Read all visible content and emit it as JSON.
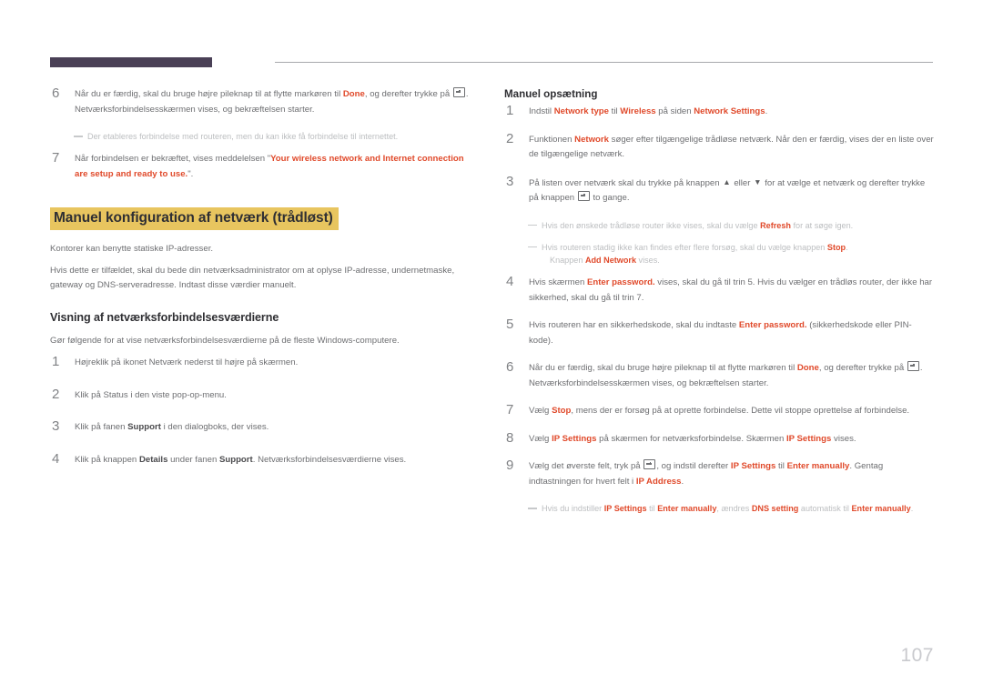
{
  "page": {
    "number": "107"
  },
  "header": {
    "accent_color": "#4a4056",
    "rule_color": "#a7a9ac"
  },
  "theme": {
    "keyword_color": "#e0492a",
    "heading_highlight": "#e8c55f",
    "body_text_color": "#6d6e71",
    "note_text_color": "#bcbec0"
  },
  "left_column": {
    "steps_continued": [
      {
        "num": "6",
        "parts": [
          {
            "t": "Når du er færdig, skal du bruge højre pileknap til at flytte markøren til ",
            "s": "plain"
          },
          {
            "t": "Done",
            "s": "kw"
          },
          {
            "t": ", og derefter trykke på ",
            "s": "plain"
          },
          {
            "t": "ENTER_ICON",
            "s": "icon"
          },
          {
            "t": ". Netværksforbindelsesskærmen vises, og bekræftelsen starter.",
            "s": "plain"
          }
        ],
        "note": {
          "parts": [
            {
              "t": "Der etableres forbindelse med routeren, men du kan ikke få forbindelse til internettet.",
              "s": "plain"
            }
          ]
        }
      },
      {
        "num": "7",
        "parts": [
          {
            "t": "Når forbindelsen er bekræftet, vises meddelelsen \"",
            "s": "plain"
          },
          {
            "t": "Your wireless network and Internet connection are setup and ready to use.",
            "s": "kw"
          },
          {
            "t": "\".",
            "s": "plain"
          }
        ]
      }
    ],
    "chapter_heading": "Manuel konfiguration af netværk (trådløst)",
    "intro_paragraphs": [
      "Kontorer kan benytte statiske IP-adresser.",
      "Hvis dette er tilfældet, skal du bede din netværksadministrator om at oplyse IP-adresse, undernetmaske, gateway og DNS-serveradresse. Indtast disse værdier manuelt."
    ],
    "sub_heading": "Visning af netværksforbindelsesværdierne",
    "sub_intro": "Gør følgende for at vise netværksforbindelsesværdierne på de fleste Windows-computere.",
    "steps": [
      {
        "num": "1",
        "parts": [
          {
            "t": "Højreklik på ikonet Netværk nederst til højre på skærmen.",
            "s": "plain"
          }
        ]
      },
      {
        "num": "2",
        "parts": [
          {
            "t": "Klik på Status i den viste pop-op-menu.",
            "s": "plain"
          }
        ]
      },
      {
        "num": "3",
        "parts": [
          {
            "t": "Klik på fanen ",
            "s": "plain"
          },
          {
            "t": "Support",
            "s": "bold"
          },
          {
            "t": " i den dialogboks, der vises.",
            "s": "plain"
          }
        ]
      },
      {
        "num": "4",
        "parts": [
          {
            "t": "Klik på knappen ",
            "s": "plain"
          },
          {
            "t": "Details",
            "s": "bold"
          },
          {
            "t": " under fanen ",
            "s": "plain"
          },
          {
            "t": "Support",
            "s": "bold"
          },
          {
            "t": ". Netværksforbindelsesværdierne vises.",
            "s": "plain"
          }
        ]
      }
    ]
  },
  "right_column": {
    "heading": "Manuel opsætning",
    "steps": [
      {
        "num": "1",
        "parts": [
          {
            "t": "Indstil ",
            "s": "plain"
          },
          {
            "t": "Network type",
            "s": "kw"
          },
          {
            "t": " til ",
            "s": "plain"
          },
          {
            "t": "Wireless",
            "s": "kw"
          },
          {
            "t": " på siden ",
            "s": "plain"
          },
          {
            "t": "Network Settings",
            "s": "kw"
          },
          {
            "t": ".",
            "s": "plain"
          }
        ]
      },
      {
        "num": "2",
        "parts": [
          {
            "t": "Funktionen ",
            "s": "plain"
          },
          {
            "t": "Network",
            "s": "kw"
          },
          {
            "t": " søger efter tilgængelige trådløse netværk. Når den er færdig, vises der en liste over de tilgængelige netværk.",
            "s": "plain"
          }
        ]
      },
      {
        "num": "3",
        "parts": [
          {
            "t": "På listen over netværk skal du trykke på knappen ",
            "s": "plain"
          },
          {
            "t": "▲",
            "s": "arrow"
          },
          {
            "t": " eller ",
            "s": "plain"
          },
          {
            "t": "▼",
            "s": "arrow"
          },
          {
            "t": " for at vælge et netværk og derefter trykke på knappen ",
            "s": "plain"
          },
          {
            "t": "ENTER_ICON",
            "s": "icon"
          },
          {
            "t": " to gange.",
            "s": "plain"
          }
        ],
        "notes": [
          {
            "parts": [
              {
                "t": "Hvis den ønskede trådløse router ikke vises, skal du vælge ",
                "s": "plain"
              },
              {
                "t": "Refresh",
                "s": "kw"
              },
              {
                "t": " for at søge igen.",
                "s": "plain"
              }
            ]
          },
          {
            "parts": [
              {
                "t": "Hvis routeren stadig ikke kan findes efter flere forsøg, skal du vælge knappen ",
                "s": "plain"
              },
              {
                "t": "Stop",
                "s": "kw"
              },
              {
                "t": ".",
                "s": "plain"
              }
            ],
            "continuation": [
              {
                "t": "Knappen ",
                "s": "plain"
              },
              {
                "t": "Add Network",
                "s": "kw"
              },
              {
                "t": " vises.",
                "s": "plain"
              }
            ]
          }
        ]
      },
      {
        "num": "4",
        "parts": [
          {
            "t": "Hvis skærmen ",
            "s": "plain"
          },
          {
            "t": "Enter password.",
            "s": "kw"
          },
          {
            "t": " vises, skal du gå til trin 5. Hvis du vælger en trådløs router, der ikke har sikkerhed, skal du gå til trin 7.",
            "s": "plain"
          }
        ]
      },
      {
        "num": "5",
        "parts": [
          {
            "t": "Hvis routeren har en sikkerhedskode, skal du indtaste ",
            "s": "plain"
          },
          {
            "t": "Enter password.",
            "s": "kw"
          },
          {
            "t": " (sikkerhedskode eller PIN-kode).",
            "s": "plain"
          }
        ]
      },
      {
        "num": "6",
        "parts": [
          {
            "t": "Når du er færdig, skal du bruge højre pileknap til at flytte markøren til ",
            "s": "plain"
          },
          {
            "t": "Done",
            "s": "kw"
          },
          {
            "t": ", og derefter trykke på ",
            "s": "plain"
          },
          {
            "t": "ENTER_ICON",
            "s": "icon"
          },
          {
            "t": ". Netværksforbindelsesskærmen vises, og bekræftelsen starter.",
            "s": "plain"
          }
        ]
      },
      {
        "num": "7",
        "parts": [
          {
            "t": "Vælg ",
            "s": "plain"
          },
          {
            "t": "Stop",
            "s": "kw"
          },
          {
            "t": ", mens der er forsøg på at oprette forbindelse. Dette vil stoppe oprettelse af forbindelse.",
            "s": "plain"
          }
        ]
      },
      {
        "num": "8",
        "parts": [
          {
            "t": "Vælg ",
            "s": "plain"
          },
          {
            "t": "IP Settings",
            "s": "kw"
          },
          {
            "t": " på skærmen for netværksforbindelse. Skærmen ",
            "s": "plain"
          },
          {
            "t": "IP Settings",
            "s": "kw"
          },
          {
            "t": " vises.",
            "s": "plain"
          }
        ]
      },
      {
        "num": "9",
        "parts": [
          {
            "t": "Vælg det øverste felt, tryk på ",
            "s": "plain"
          },
          {
            "t": "ENTER_ICON",
            "s": "icon"
          },
          {
            "t": ", og indstil derefter ",
            "s": "plain"
          },
          {
            "t": "IP Settings",
            "s": "kw"
          },
          {
            "t": " til ",
            "s": "plain"
          },
          {
            "t": "Enter manually",
            "s": "kw"
          },
          {
            "t": ". Gentag indtastningen for hvert felt i ",
            "s": "plain"
          },
          {
            "t": "IP Address",
            "s": "kw"
          },
          {
            "t": ".",
            "s": "plain"
          }
        ],
        "notes": [
          {
            "parts": [
              {
                "t": "Hvis du indstiller ",
                "s": "plain"
              },
              {
                "t": "IP Settings",
                "s": "kw"
              },
              {
                "t": " til ",
                "s": "plain"
              },
              {
                "t": "Enter manually",
                "s": "kw"
              },
              {
                "t": ", ændres ",
                "s": "plain"
              },
              {
                "t": "DNS setting",
                "s": "kw"
              },
              {
                "t": " automatisk til ",
                "s": "plain"
              },
              {
                "t": "Enter manually",
                "s": "kw"
              },
              {
                "t": ".",
                "s": "plain"
              }
            ]
          }
        ]
      }
    ]
  }
}
